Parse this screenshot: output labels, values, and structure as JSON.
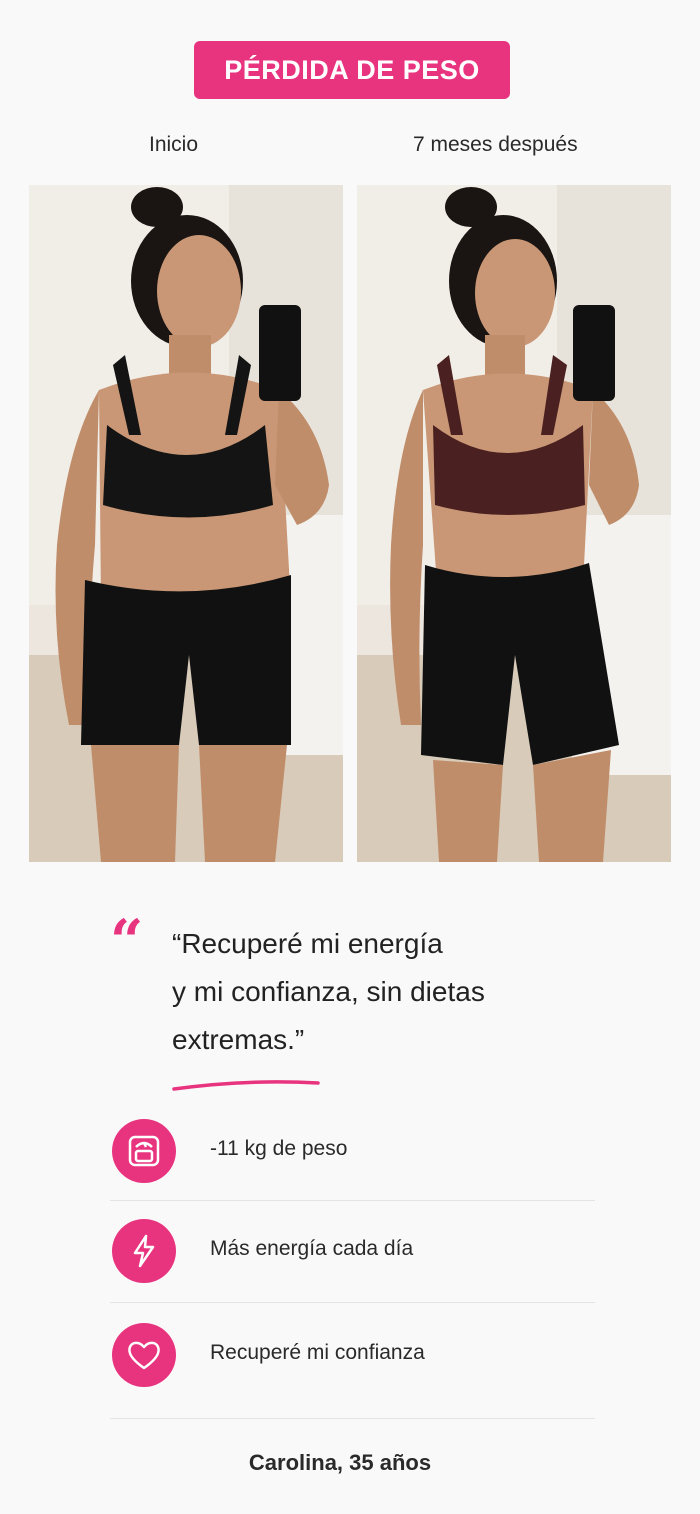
{
  "badge": {
    "label": "PÉRDIDA DE PESO",
    "color": "#e8347f"
  },
  "labels": {
    "before": "Inicio",
    "after": "7 meses después"
  },
  "photos": {
    "before_alt": "Inicio",
    "after_alt": "7 meses después"
  },
  "quote": {
    "line1": "“Recuperé mi energía",
    "line2": "y mi confianza, sin dietas",
    "line3": "extremas.”"
  },
  "stats": [
    {
      "icon": "scale-icon",
      "text": "-11 kg de peso"
    },
    {
      "icon": "lightning-icon",
      "text": "Más energía cada día"
    },
    {
      "icon": "heart-icon",
      "text": "Recuperé mi confianza"
    }
  ],
  "footer": {
    "name": "Carolina, 35 años"
  },
  "colors": {
    "accent": "#e8347f",
    "background": "#faf9fa"
  }
}
